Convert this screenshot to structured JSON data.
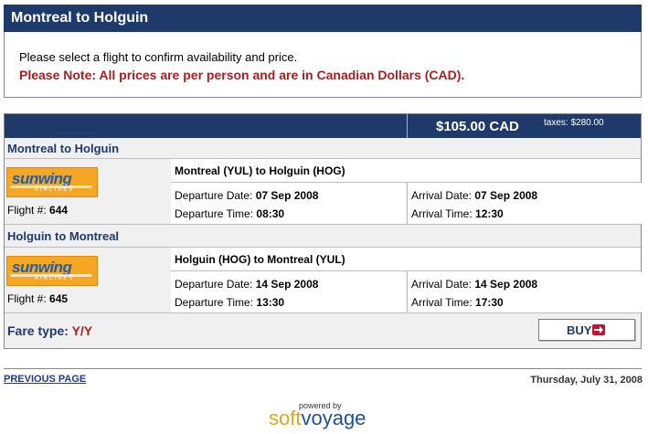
{
  "header": {
    "title": "Montreal to Holguin"
  },
  "notice": {
    "line1": "Please select a flight to confirm availability and price.",
    "line2": "Please Note: All prices are per person and are in Canadian Dollars (CAD)."
  },
  "price": {
    "main": "$105.00 CAD",
    "taxes": "taxes: $280.00"
  },
  "segments": [
    {
      "title": "Montreal to Holguin",
      "airline_logo_text": "sunwing",
      "airline_logo_sub": "AIRLINES",
      "flight_label": "Flight #:",
      "flight_no": "644",
      "route": "Montreal (YUL) to Holguin (HOG)",
      "dep_date_label": "Departure Date:",
      "dep_date": "07 Sep 2008",
      "dep_time_label": "Departure Time:",
      "dep_time": "08:30",
      "arr_date_label": "Arrival Date:",
      "arr_date": "07 Sep 2008",
      "arr_time_label": "Arrival Time:",
      "arr_time": "12:30"
    },
    {
      "title": "Holguin to Montreal",
      "airline_logo_text": "sunwing",
      "airline_logo_sub": "AIRLINES",
      "flight_label": "Flight #:",
      "flight_no": "645",
      "route": "Holguin (HOG) to Montreal (YUL)",
      "dep_date_label": "Departure Date:",
      "dep_date": "14 Sep 2008",
      "dep_time_label": "Departure Time:",
      "dep_time": "13:30",
      "arr_date_label": "Arrival Date:",
      "arr_date": "14 Sep 2008",
      "arr_time_label": "Arrival Time:",
      "arr_time": "17:30"
    }
  ],
  "fare": {
    "label": "Fare type:",
    "value": "Y/Y"
  },
  "buy_button": {
    "label": "BUY",
    "icon": "arrow-right-icon"
  },
  "footer": {
    "prev_link": "PREVIOUS PAGE",
    "date": "Thursday, July 31, 2008",
    "powered_by": "powered by",
    "brand_soft": "soft",
    "brand_voyage": "voyage"
  },
  "colors": {
    "navy": "#1e3a6b",
    "red": "#b01c1c",
    "logo_orange": "#f5a623"
  }
}
